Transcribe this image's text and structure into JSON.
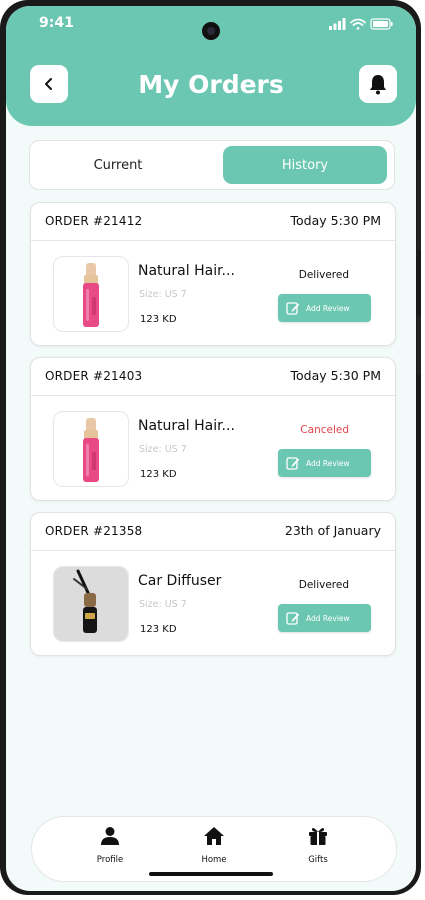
{
  "status_bar": {
    "time": "9:41"
  },
  "header": {
    "title": "My Orders"
  },
  "tabs": [
    {
      "label": "Current",
      "active": false
    },
    {
      "label": "History",
      "active": true
    }
  ],
  "orders": [
    {
      "id": "ORDER #21412",
      "time": "Today 5:30 PM",
      "product": "Natural Hair...",
      "size": "Size: US 7",
      "price": "123 KD",
      "status": "Delivered",
      "action": "Add Review",
      "thumb": "pink-bottle"
    },
    {
      "id": "ORDER #21403",
      "time": "Today 5:30 PM",
      "product": "Natural Hair...",
      "size": "Size: US 7",
      "price": "123 KD",
      "status": "Canceled",
      "action": "Add Review",
      "thumb": "pink-bottle"
    },
    {
      "id": "ORDER #21358",
      "time": "23th of January",
      "product": "Car Diffuser",
      "size": "Size: US 7",
      "price": "123 KD",
      "status": "Delivered",
      "action": "Add Review",
      "thumb": "car-diffuser"
    }
  ],
  "bottom_nav": [
    {
      "label": "Profile",
      "icon": "person-icon"
    },
    {
      "label": "Home",
      "icon": "home-icon"
    },
    {
      "label": "Gifts",
      "icon": "gift-icon"
    }
  ],
  "colors": {
    "accent": "#6cc7b2",
    "canceled": "#e2444a",
    "background": "#f3fbfa"
  }
}
